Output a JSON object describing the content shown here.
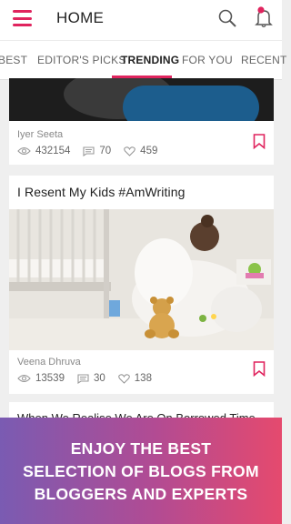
{
  "header": {
    "title": "HOME"
  },
  "tabs": [
    {
      "label": "BEST"
    },
    {
      "label": "EDITOR'S PICKS"
    },
    {
      "label": "TRENDING"
    },
    {
      "label": "FOR YOU"
    },
    {
      "label": "RECENT"
    }
  ],
  "active_tab": "TRENDING",
  "posts": [
    {
      "author": "Iyer Seeta",
      "views": "432154",
      "comments": "70",
      "likes": "459"
    },
    {
      "title": "I Resent My Kids #AmWriting",
      "author": "Veena Dhruva",
      "views": "13539",
      "comments": "30",
      "likes": "138"
    },
    {
      "title": "When We Realise We Are On Borrowed Time"
    }
  ],
  "promo": {
    "line1": "ENJOY THE BEST",
    "line2": "SELECTION OF BLOGS FROM",
    "line3": "BLOGGERS AND EXPERTS"
  },
  "colors": {
    "accent": "#e0245e",
    "promo_start": "#7a5bb2",
    "promo_end": "#e54a6e"
  },
  "icons": [
    "menu-icon",
    "search-icon",
    "notification-bell-icon",
    "eye-icon",
    "comment-icon",
    "heart-icon",
    "bookmark-icon"
  ]
}
